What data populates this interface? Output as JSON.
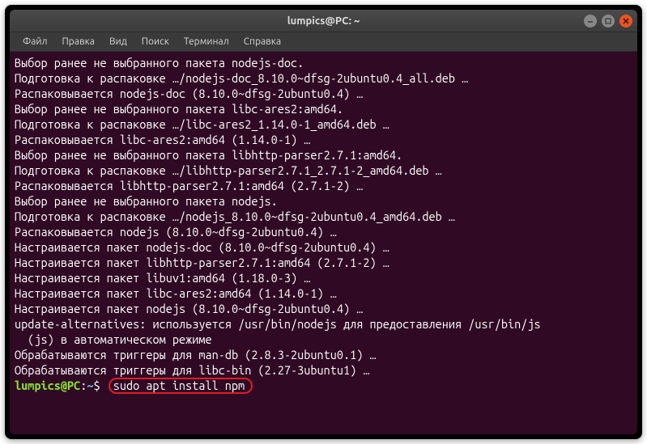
{
  "window": {
    "title": "lumpics@PC: ~"
  },
  "menubar": {
    "items": [
      "Файл",
      "Правка",
      "Вид",
      "Поиск",
      "Терминал",
      "Справка"
    ]
  },
  "terminal": {
    "lines": [
      "Выбор ранее не выбранного пакета nodejs-doc.",
      "Подготовка к распаковке …/nodejs-doc_8.10.0~dfsg-2ubuntu0.4_all.deb …",
      "Распаковывается nodejs-doc (8.10.0~dfsg-2ubuntu0.4) …",
      "Выбор ранее не выбранного пакета libc-ares2:amd64.",
      "Подготовка к распаковке …/libc-ares2_1.14.0-1_amd64.deb …",
      "Распаковывается libc-ares2:amd64 (1.14.0-1) …",
      "Выбор ранее не выбранного пакета libhttp-parser2.7.1:amd64.",
      "Подготовка к распаковке …/libhttp-parser2.7.1_2.7.1-2_amd64.deb …",
      "Распаковывается libhttp-parser2.7.1:amd64 (2.7.1-2) …",
      "Выбор ранее не выбранного пакета nodejs.",
      "Подготовка к распаковке …/nodejs_8.10.0~dfsg-2ubuntu0.4_amd64.deb …",
      "Распаковывается nodejs (8.10.0~dfsg-2ubuntu0.4) …",
      "Настраивается пакет nodejs-doc (8.10.0~dfsg-2ubuntu0.4) …",
      "Настраивается пакет libhttp-parser2.7.1:amd64 (2.7.1-2) …",
      "Настраивается пакет libuv1:amd64 (1.18.0-3) …",
      "Настраивается пакет libc-ares2:amd64 (1.14.0-1) …",
      "Настраивается пакет nodejs (8.10.0~dfsg-2ubuntu0.4) …",
      "update-alternatives: используется /usr/bin/nodejs для предоставления /usr/bin/js",
      "  (js) в автоматическом режиме",
      "Обрабатываются триггеры для man-db (2.8.3-2ubuntu0.1) …",
      "Обрабатываются триггеры для libc-bin (2.27-3ubuntu1) …"
    ],
    "prompt": {
      "user": "lumpics@PC",
      "path": "~",
      "sep": ":",
      "dollar": "$",
      "command": "sudo apt install npm"
    }
  }
}
